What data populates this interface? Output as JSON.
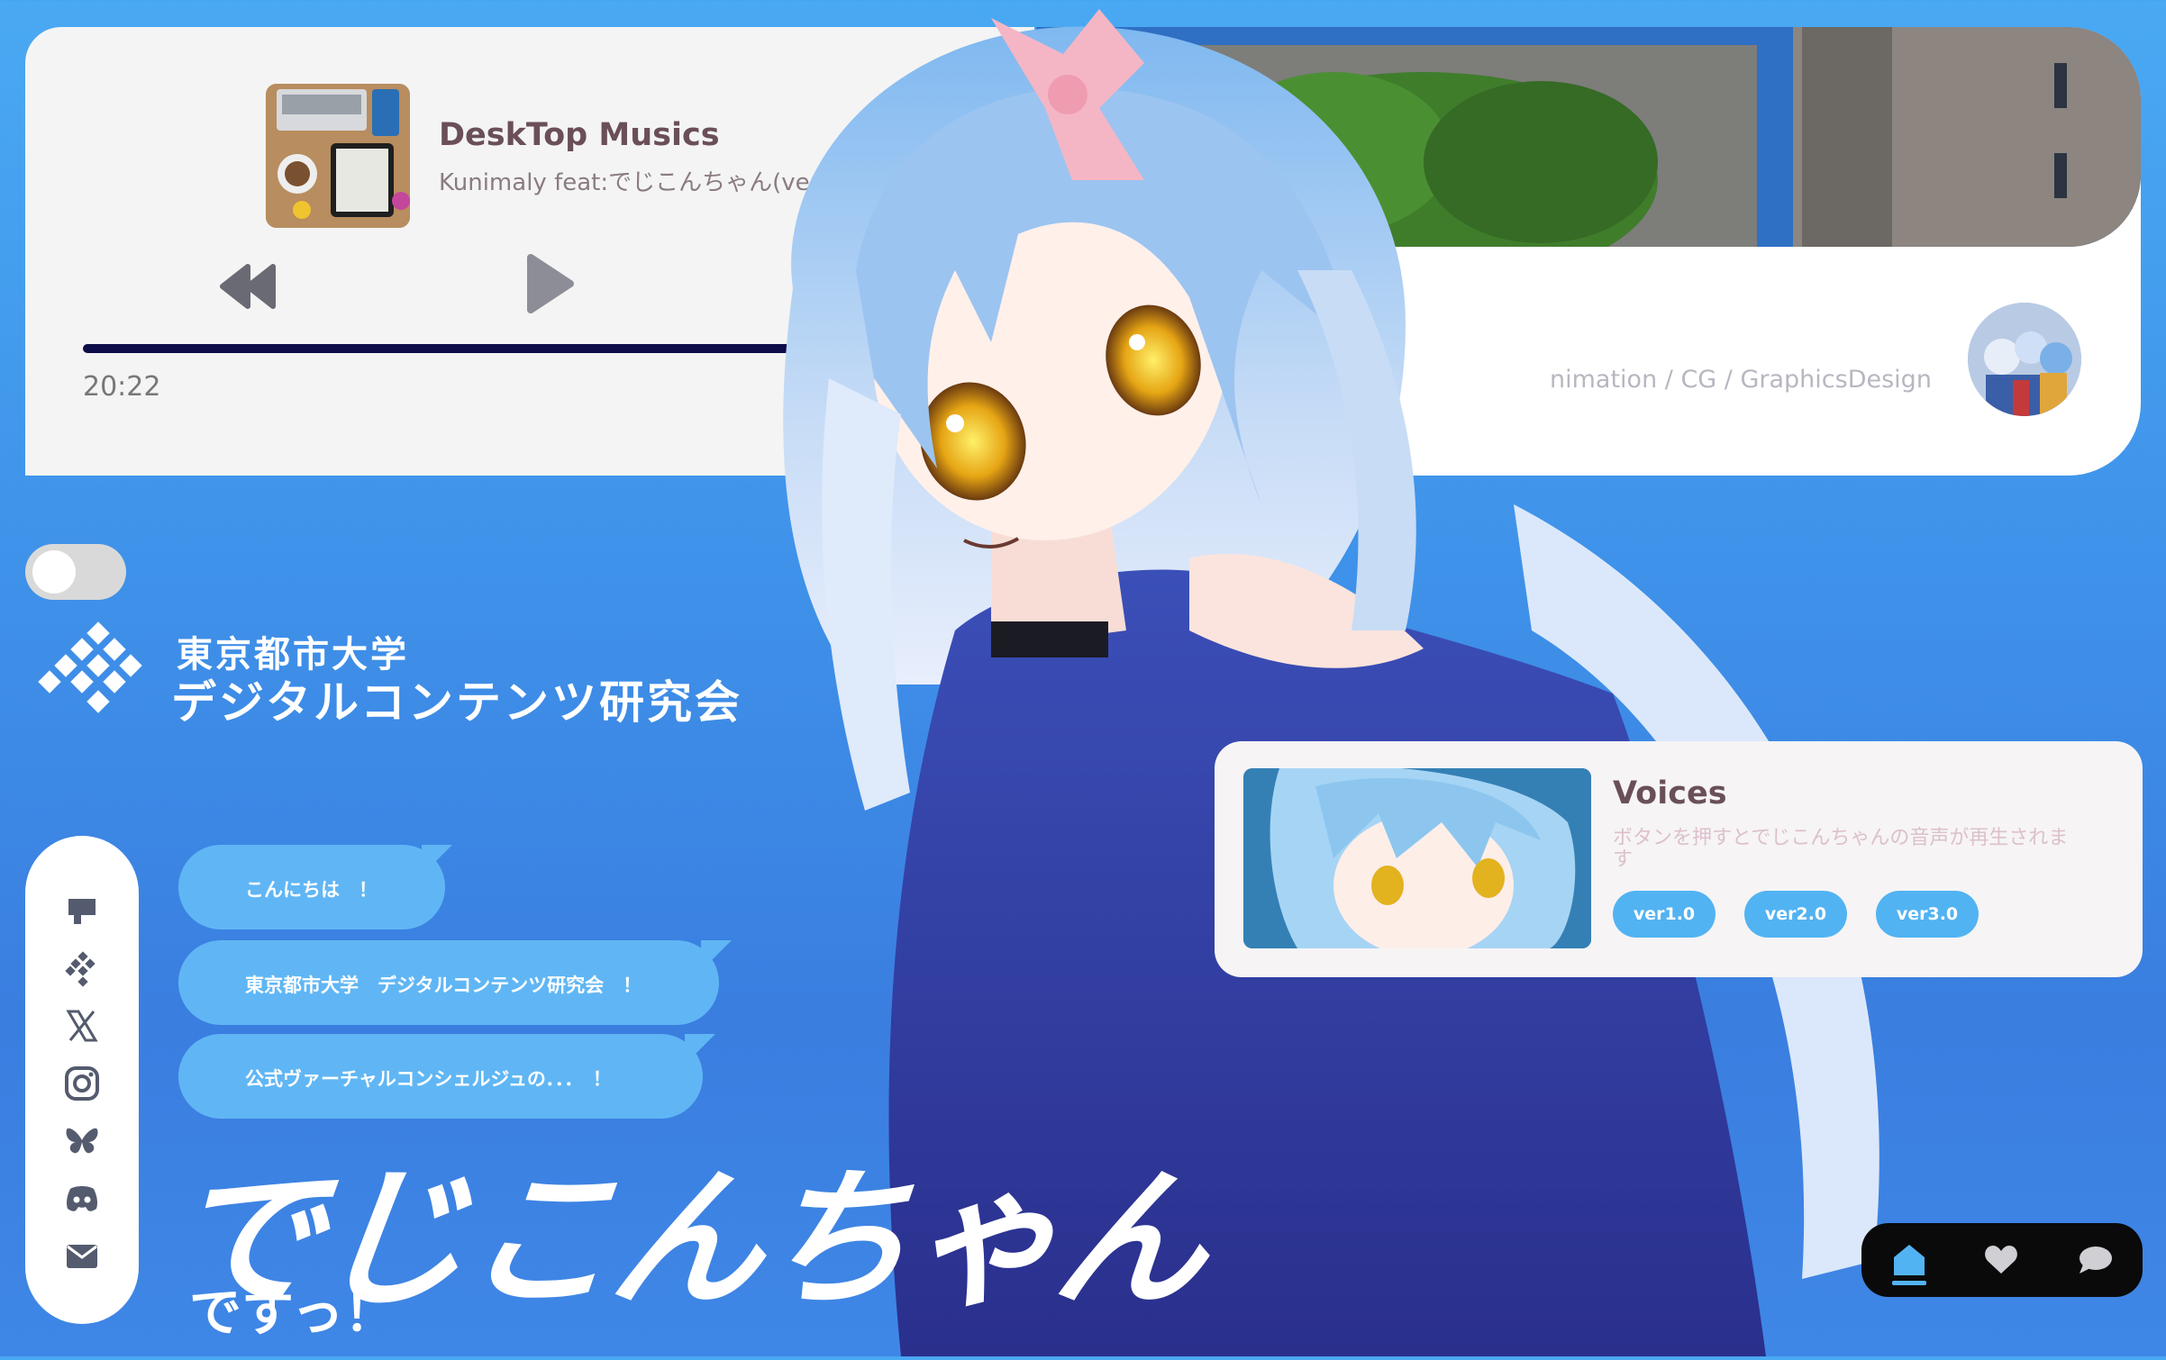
{
  "music_player": {
    "track_title": "DeskTop Musics",
    "track_artist": "Kunimaly feat:でじこんちゃん(ver0)",
    "elapsed": "20:22",
    "progress_percent": 81,
    "rewind_icon": "rewind-icon",
    "play_icon": "play-icon"
  },
  "info_card": {
    "tags": "nimation / CG / GraphicsDesign"
  },
  "toggle": {
    "state": "off"
  },
  "logo": {
    "line1": "東京都市大学",
    "line2": "デジタルコンテンツ研究会"
  },
  "social": [
    "flag-icon",
    "club-logo-icon",
    "x-icon",
    "instagram-icon",
    "bluesky-icon",
    "discord-icon",
    "mail-icon"
  ],
  "bubbles": [
    "こんにちは　！",
    "東京都市大学　デジタルコンテンツ研究会　！",
    "公式ヴァーチャルコンシェルジュの．．．　！"
  ],
  "character": {
    "name": "でじこんちゃん",
    "suffix": "ですっ！"
  },
  "voices": {
    "title": "Voices",
    "description": "ボタンを押すとでじこんちゃんの音声が再生されます",
    "buttons": [
      "ver1.0",
      "ver2.0",
      "ver3.0"
    ]
  },
  "bottom_nav": {
    "items": [
      "home-icon",
      "heart-icon",
      "chat-icon"
    ],
    "active": "home-icon",
    "active_color": "#52b3f2"
  }
}
